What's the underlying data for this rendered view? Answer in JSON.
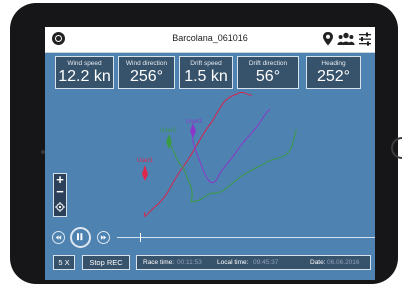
{
  "header": {
    "title": "Barcolana_061016"
  },
  "tiles": [
    {
      "label": "Wind speed",
      "value": "12.2 kn"
    },
    {
      "label": "Wind direction",
      "value": "256°"
    },
    {
      "label": "Drift speed",
      "value": "1.5 kn"
    },
    {
      "label": "Drift direction",
      "value": "56°"
    },
    {
      "label": "Heading",
      "value": "252°"
    }
  ],
  "boats": [
    {
      "label": "User1",
      "color": "#e0264b"
    },
    {
      "label": "User2",
      "color": "#3c9a45"
    },
    {
      "label": "User3",
      "color": "#8a38c8"
    }
  ],
  "zoom": {
    "in_label": "+",
    "out_label": "−"
  },
  "playback": {
    "speed_label": "5 X",
    "stop_rec_label": "Stop REC"
  },
  "status": {
    "race_time_label": "Race time:",
    "race_time_value": "00:11:53",
    "local_time_label": "Local time:",
    "local_time_value": "09:45:37",
    "date_label": "Date:",
    "date_value": "06.06.2016"
  },
  "icons": {
    "logo": "app-logo-icon",
    "location": "location-pin-icon",
    "users": "users-group-icon",
    "settings": "sliders-icon",
    "rewind": "rewind-icon",
    "pause": "pause-icon",
    "fast_forward": "fast-forward-icon",
    "locate": "locate-icon"
  },
  "colors": {
    "sea": "#4e82b1",
    "panel": "#37526b",
    "topbar": "#ffffff"
  }
}
